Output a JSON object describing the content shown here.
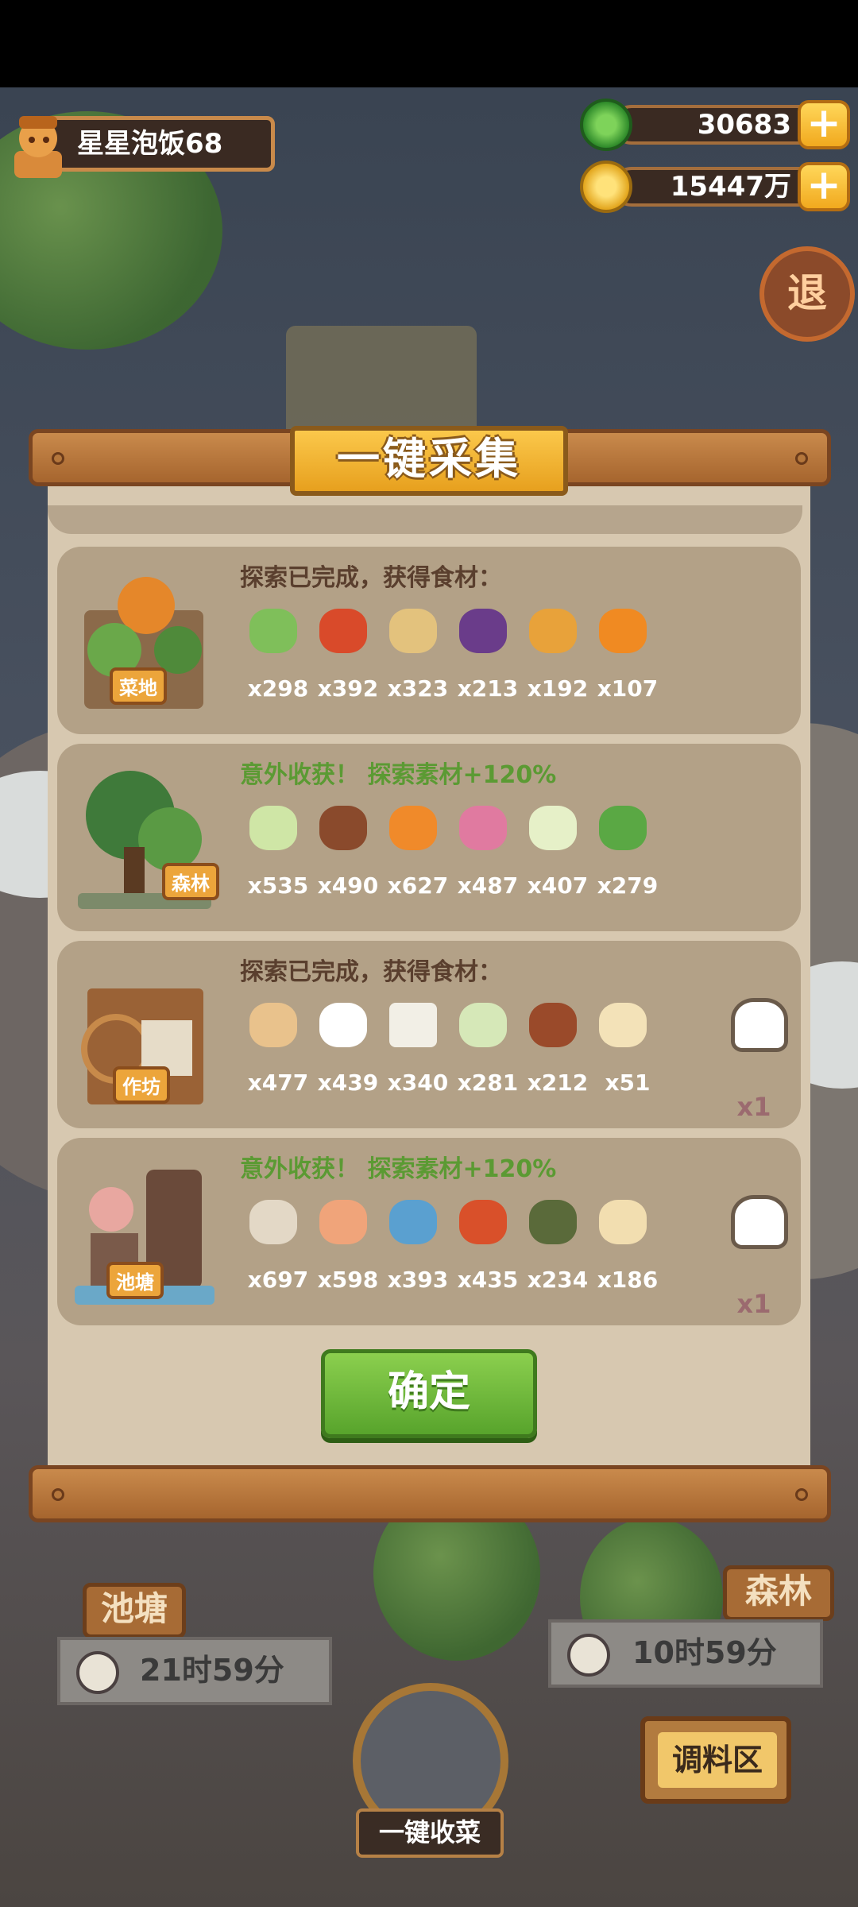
{
  "player": {
    "name": "星星泡饭68"
  },
  "currency": {
    "jade": {
      "value": "30683",
      "icon": "jade-coin-icon"
    },
    "gold": {
      "value": "15447万",
      "icon": "gold-coin-icon"
    }
  },
  "exit_label": "退",
  "modal": {
    "title": "一键采集",
    "rows": [
      {
        "location": "菜地",
        "heading": "探索已完成，获得食材：",
        "bonus": false,
        "items": [
          {
            "icon": "leek-icon",
            "qty": "x298",
            "color": "#7fbf5a"
          },
          {
            "icon": "chili-icon",
            "qty": "x392",
            "color": "#d94a2a"
          },
          {
            "icon": "potato-icon",
            "qty": "x323",
            "color": "#e3c27d"
          },
          {
            "icon": "eggplant-icon",
            "qty": "x213",
            "color": "#6a3c8a"
          },
          {
            "icon": "pumpkin-corn-icon",
            "qty": "x192",
            "color": "#e8a23a"
          },
          {
            "icon": "pumpkin-icon",
            "qty": "x107",
            "color": "#f08a22"
          }
        ],
        "extra": null
      },
      {
        "location": "森林",
        "heading": "意外收获！ 探索素材+120%",
        "bonus": true,
        "items": [
          {
            "icon": "cabbage-icon",
            "qty": "x535",
            "color": "#cfe6a6"
          },
          {
            "icon": "mushroom-icon",
            "qty": "x490",
            "color": "#8a4a2c"
          },
          {
            "icon": "carrot-icon",
            "qty": "x627",
            "color": "#f08a2a"
          },
          {
            "icon": "onion-icon",
            "qty": "x487",
            "color": "#e07aa0"
          },
          {
            "icon": "bamboo-shoot-icon",
            "qty": "x407",
            "color": "#e6f0c8"
          },
          {
            "icon": "herb-leaves-icon",
            "qty": "x279",
            "color": "#5aa844"
          }
        ],
        "extra": null
      },
      {
        "location": "作坊",
        "heading": "探索已完成，获得食材：",
        "bonus": false,
        "items": [
          {
            "icon": "flour-sack-icon",
            "qty": "x477",
            "color": "#e9c28c"
          },
          {
            "icon": "rice-bowl-icon",
            "qty": "x439",
            "color": "#ffffff"
          },
          {
            "icon": "tofu-icon",
            "qty": "x340",
            "color": "#f2efe6"
          },
          {
            "icon": "rice-pile-icon",
            "qty": "x281",
            "color": "#d6e8b8"
          },
          {
            "icon": "sauce-jar-icon",
            "qty": "x212",
            "color": "#9a4a2a"
          },
          {
            "icon": "gravy-boat-icon",
            "qty": "x51",
            "color": "#f3e2b8"
          }
        ],
        "extra": {
          "icon": "rare-item-bell-icon",
          "qty": "x1"
        }
      },
      {
        "location": "池塘",
        "heading": "意外收获！ 探索素材+120%",
        "bonus": true,
        "items": [
          {
            "icon": "clam-icon",
            "qty": "x697",
            "color": "#e3d8c6"
          },
          {
            "icon": "shrimp-icon",
            "qty": "x598",
            "color": "#f0a47a"
          },
          {
            "icon": "fish-icon",
            "qty": "x393",
            "color": "#5aa0d0"
          },
          {
            "icon": "meat-chunk-icon",
            "qty": "x435",
            "color": "#d9502a"
          },
          {
            "icon": "crab-icon",
            "qty": "x234",
            "color": "#5a6a3a"
          },
          {
            "icon": "shark-fin-icon",
            "qty": "x186",
            "color": "#f2deb0"
          }
        ],
        "extra": {
          "icon": "rare-crab-bell-icon",
          "qty": "x1"
        }
      }
    ],
    "confirm_label": "确定"
  },
  "bottom": {
    "pond_label": "池塘",
    "pond_timer": "21时59分",
    "forest_label": "森林",
    "forest_timer": "10时59分",
    "seasoning_sign": "调料区",
    "harvest_all": "一键收菜"
  }
}
